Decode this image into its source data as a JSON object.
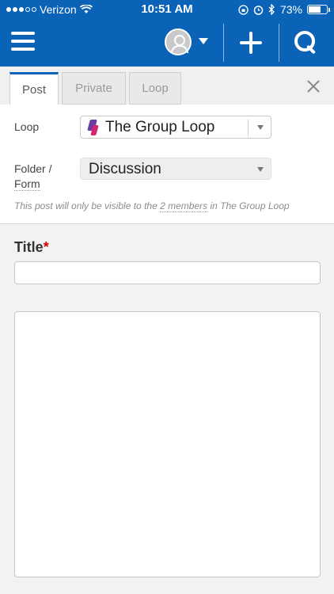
{
  "status_bar": {
    "carrier": "Verizon",
    "time": "10:51 AM",
    "battery": "73%",
    "battery_level": 0.73,
    "icons": [
      "signal-dots-icon",
      "wifi-icon",
      "screen-lock-icon",
      "alarm-icon",
      "bluetooth-icon",
      "battery-icon"
    ]
  },
  "nav": {
    "icons": [
      "menu-icon",
      "avatar-icon",
      "chevron-down-icon",
      "plus-icon",
      "search-icon"
    ],
    "accent_color": "#0a63b6"
  },
  "tabs": [
    {
      "label": "Post",
      "active": true
    },
    {
      "label": "Private",
      "active": false
    },
    {
      "label": "Loop",
      "active": false
    }
  ],
  "form": {
    "loop_label": "Loop",
    "loop_value": "The Group Loop",
    "folder_label_1": "Folder /",
    "folder_label_2": "Form",
    "folder_value": "Discussion",
    "visibility_note_prefix": "This post will only be visible to the",
    "visibility_note_link": "2 members",
    "visibility_note_suffix": "in The Group Loop",
    "title_label": "Title",
    "required_mark": "*",
    "title_value": "",
    "body_value": ""
  }
}
